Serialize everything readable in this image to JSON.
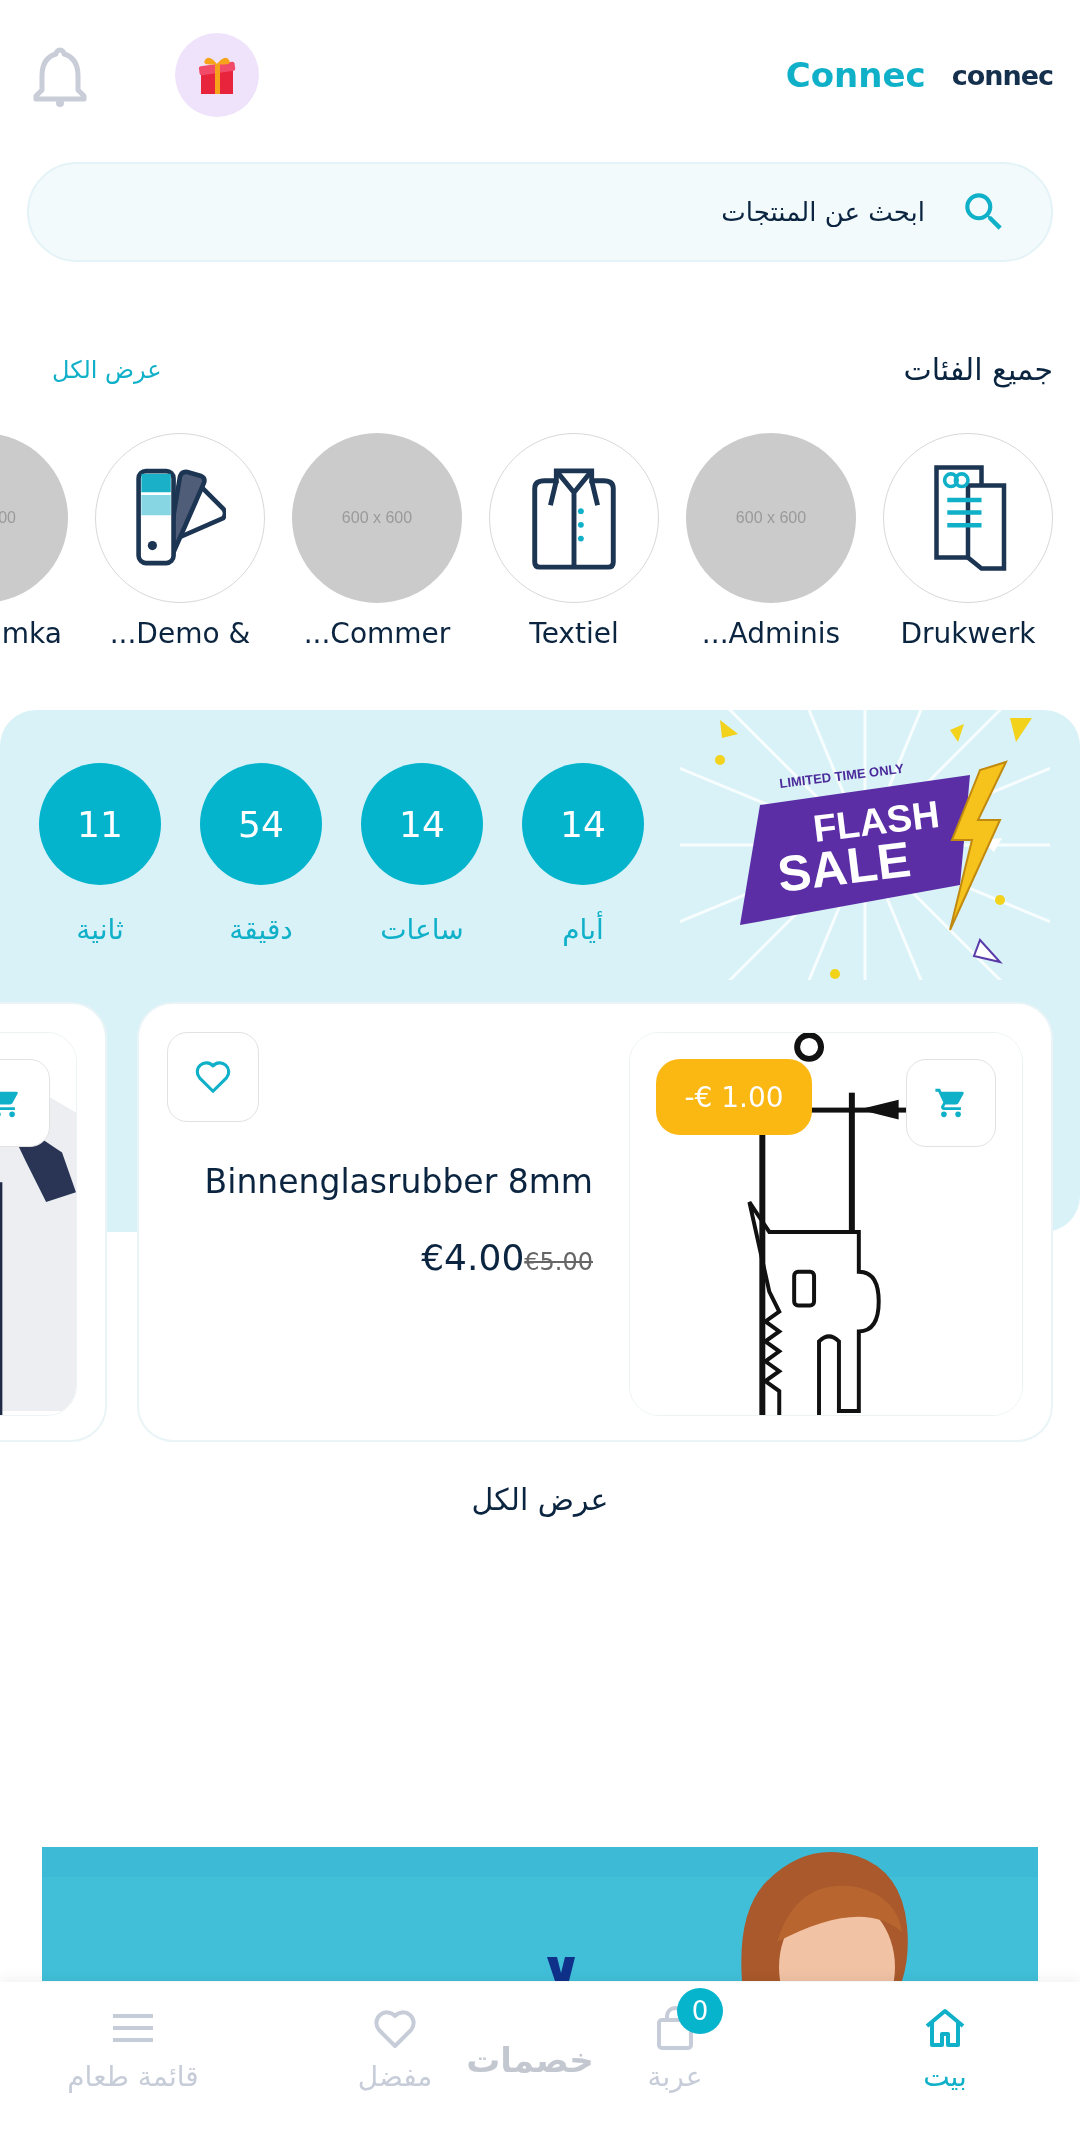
{
  "header": {
    "brand_text": "Connec",
    "logo_text": "connec"
  },
  "search": {
    "placeholder": "ابحث عن المنتجات"
  },
  "categories_section": {
    "title": "جميع الفئات",
    "view_all": "عرض الكل"
  },
  "categories": [
    {
      "label": "Drukwerk",
      "kind": "document"
    },
    {
      "label": "...Adminis",
      "kind": "placeholder",
      "placeholder_text": "600 x 600"
    },
    {
      "label": "Textiel",
      "kind": "shirt"
    },
    {
      "label": "...Commer",
      "kind": "placeholder",
      "placeholder_text": "600 x 600"
    },
    {
      "label": "...Demo &",
      "kind": "swatch"
    },
    {
      "label": "mka",
      "kind": "placeholder",
      "placeholder_text": "00"
    }
  ],
  "flash_sale": {
    "tagline": "LIMITED TIME ONLY",
    "title_line1": "FLASH",
    "title_line2": "SALE",
    "countdown": [
      {
        "value": "14",
        "unit": "أيام"
      },
      {
        "value": "14",
        "unit": "ساعات"
      },
      {
        "value": "54",
        "unit": "دقيقة"
      },
      {
        "value": "11",
        "unit": "ثانية"
      }
    ]
  },
  "products": [
    {
      "kind": "full",
      "name": "Binnenglasrubber 8mm",
      "price": "€4.00",
      "old_price": "€5.00",
      "discount": "-€ 1.00"
    },
    {
      "kind": "partial"
    }
  ],
  "products_view_all": "عرض الكل",
  "bottom_nav": {
    "center_label": "خصمات",
    "items": [
      {
        "label": "بيت",
        "kind": "home",
        "selected": true
      },
      {
        "label": "عربة",
        "kind": "bag",
        "selected": false,
        "badge": "0"
      },
      {
        "label": "مفضل",
        "kind": "heart",
        "selected": false
      },
      {
        "label": "قائمة طعام",
        "kind": "menu",
        "selected": false
      }
    ]
  }
}
